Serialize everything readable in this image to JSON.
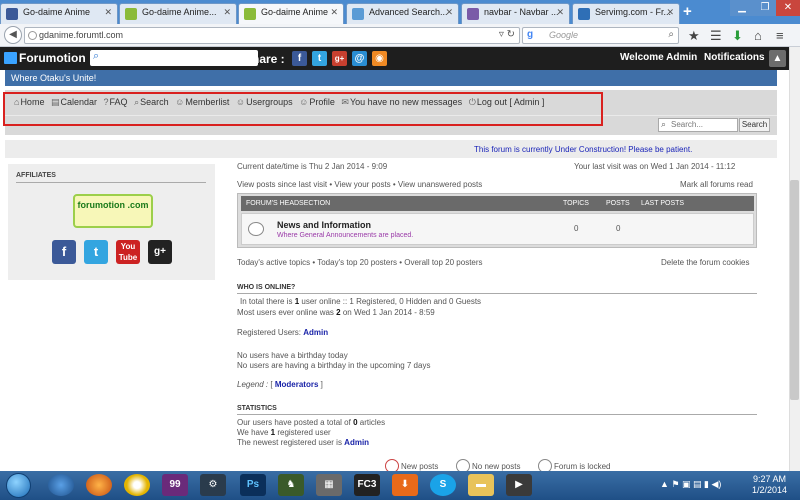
{
  "browser": {
    "tabs": [
      {
        "label": "Go-daime Anime",
        "color": "#3b5998"
      },
      {
        "label": "Go-daime Anime...",
        "color": "#8bbb3a"
      },
      {
        "label": "Go-daime Anime",
        "color": "#8bbb3a",
        "active": true
      },
      {
        "label": "Advanced Search...",
        "color": "#5a9bd5"
      },
      {
        "label": "navbar - Navbar ...",
        "color": "#7a5ba8"
      },
      {
        "label": "Servimg.com - Fr...",
        "color": "#2f6fb6"
      }
    ],
    "url": "gdanime.forumtl.com",
    "search_placeholder": "Google"
  },
  "forumotion_bar": {
    "logo": "Forumotion",
    "share_label": "Share :",
    "welcome": "Welcome Admin",
    "notifications": "Notifications"
  },
  "header": {
    "description": "Where Otaku's Unite!"
  },
  "menu": {
    "items": [
      "Home",
      "Calendar",
      "FAQ",
      "Search",
      "Memberlist",
      "Usergroups",
      "Profile",
      "You have no new messages",
      "Log out [ Admin ]"
    ],
    "search_placeholder": "Search...",
    "search_button": "Search"
  },
  "announcement": "This forum is currently Under Construction! Please be patient.",
  "sidebar": {
    "title": "AFFILIATES",
    "badge": "forumotion .com"
  },
  "main": {
    "datetime": "Current date/time is Thu 2 Jan 2014 - 9:09",
    "last_visit": "Your last visit was on Wed 1 Jan 2014 - 11:12",
    "links_left": "View posts since last visit • View your posts • View unanswered posts",
    "mark_read": "Mark all forums read",
    "forum_table": {
      "headers": [
        "FORUM'S HEADSECTION",
        "TOPICS",
        "POSTS",
        "LAST POSTS"
      ],
      "rows": [
        {
          "title": "News and Information",
          "desc": "Where General Announcements are placed.",
          "topics": "0",
          "posts": "0"
        }
      ]
    },
    "top_links": "Today's active topics • Today's top 20 posters • Overall top 20 posters",
    "delete_cookies": "Delete the forum cookies",
    "who_title": "WHO IS ONLINE?",
    "online_pre": "In total there is ",
    "online_count": "1",
    "online_post": " user online :: 1 Registered, 0 Hidden and 0 Guests",
    "most_pre": "Most users ever online was ",
    "most_count": "2",
    "most_post": " on Wed 1 Jan 2014 - 8:59",
    "registered_label": "Registered Users: ",
    "registered_user": "Admin",
    "birthday1": "No users have a birthday today",
    "birthday2": "No users are having a birthday in the upcoming 7 days",
    "legend_label": "Legend : ",
    "legend_value": "Moderators",
    "stats_title": "STATISTICS",
    "stats_pre": "Our users have posted a total of ",
    "stats_articles": "0",
    "stats_post": " articles",
    "reg_pre": "We have ",
    "reg_count": "1",
    "reg_post": " registered user",
    "newest_pre": "The newest registered user is ",
    "newest_user": "Admin",
    "icon_legend": [
      "New posts",
      "No new posts",
      "Forum is locked"
    ]
  },
  "taskbar": {
    "time": "9:27 AM",
    "date": "1/2/2014"
  }
}
